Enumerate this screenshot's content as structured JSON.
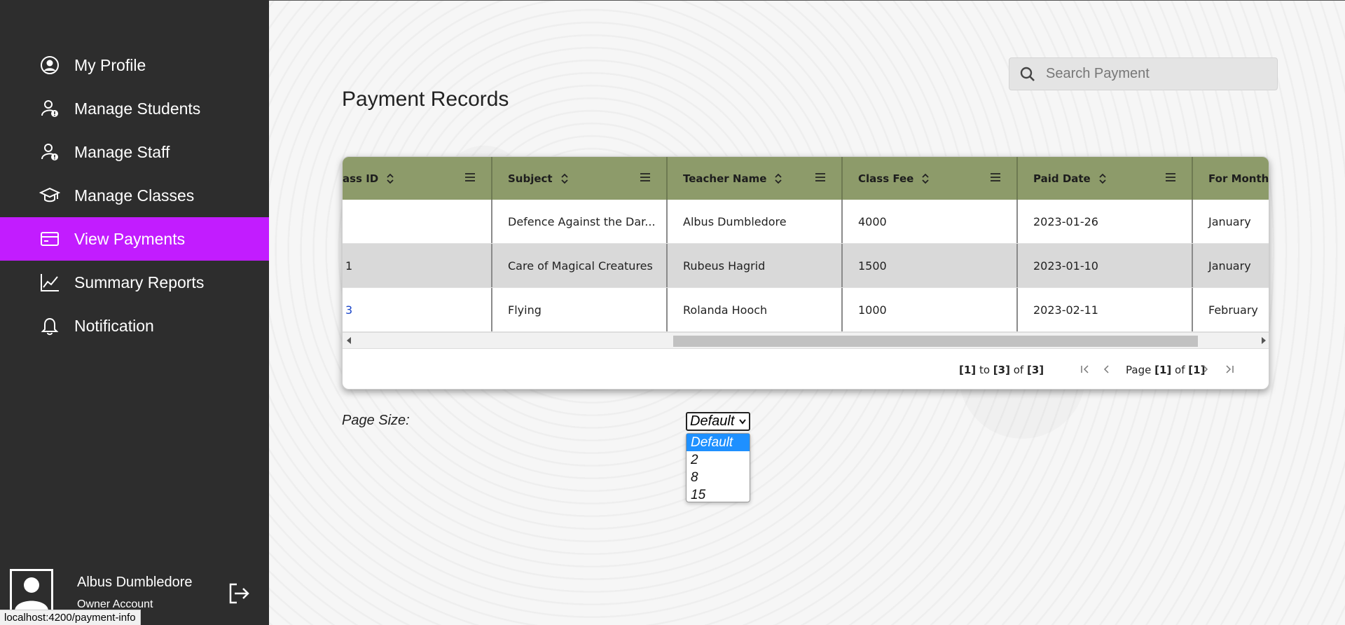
{
  "sidebar": {
    "items": [
      {
        "label": "My Profile",
        "icon": "user-circle-icon"
      },
      {
        "label": "Manage Students",
        "icon": "user-alert-icon"
      },
      {
        "label": "Manage Staff",
        "icon": "user-alert-icon"
      },
      {
        "label": "Manage Classes",
        "icon": "graduation-cap-icon"
      },
      {
        "label": "View Payments",
        "icon": "credit-card-icon",
        "active": true
      },
      {
        "label": "Summary Reports",
        "icon": "line-chart-icon"
      },
      {
        "label": "Notification",
        "icon": "bell-icon"
      }
    ],
    "user": {
      "name": "Albus Dumbledore",
      "role": "Owner Account"
    },
    "active_color": "#c21cff"
  },
  "status_url": "localhost:4200/payment-info",
  "search": {
    "placeholder": "Search Payment"
  },
  "page_title": "Payment Records",
  "grid": {
    "columns": [
      "ass ID",
      "Subject",
      "Teacher Name",
      "Class Fee",
      "Paid Date",
      "For Month"
    ],
    "rows": [
      [
        "",
        "Defence Against the Dar...",
        "Albus Dumbledore",
        "4000",
        "2023-01-26",
        "January"
      ],
      [
        "1",
        "Care of Magical Creatures",
        "Rubeus Hagrid",
        "1500",
        "2023-01-10",
        "January"
      ],
      [
        "3",
        "Flying",
        "Rolanda Hooch",
        "1000",
        "2023-02-11",
        "February"
      ]
    ],
    "header_color": "#8d9b6a",
    "pager": {
      "from": "[1]",
      "to_label": "to",
      "to": "[3]",
      "of_label": "of",
      "total": "[3]",
      "page_label": "Page",
      "page": "[1]",
      "pages": "[1]"
    }
  },
  "page_size": {
    "label": "Page Size:",
    "selected": "Default",
    "options": [
      "Default",
      "2",
      "8",
      "15"
    ]
  }
}
